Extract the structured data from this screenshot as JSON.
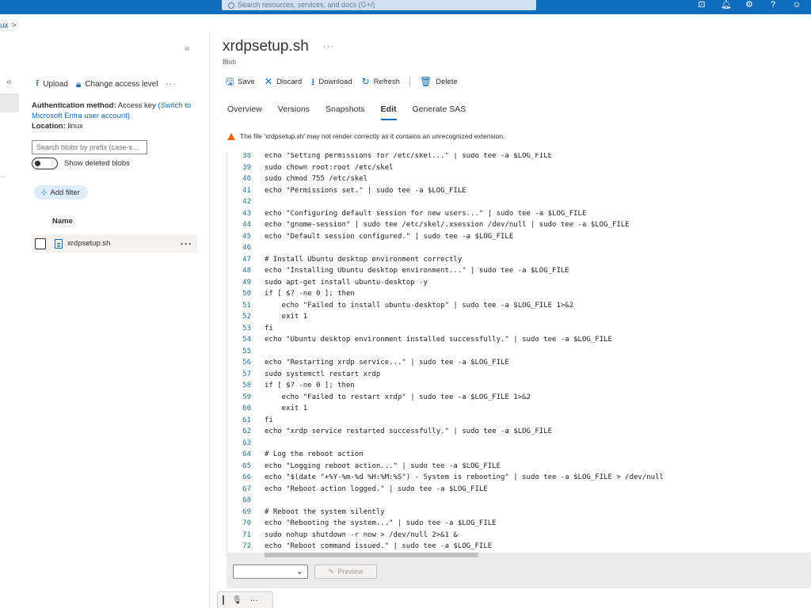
{
  "topbar": {
    "search_placeholder": "Search resources, services, and docs (G+/)",
    "icons": [
      "cloud-shell-icon",
      "notifications-icon",
      "settings-icon",
      "help-icon",
      "feedback-icon"
    ]
  },
  "breadcrumb": {
    "last": "ux",
    "separator": ">"
  },
  "left": {
    "collapse": "«",
    "collapse2": "«",
    "toolbar": {
      "upload": "Upload",
      "change_access": "Change access level",
      "more": "···"
    },
    "auth_label": "Authentication method:",
    "auth_value": "Access key",
    "auth_link": "(Switch to Microsoft Entra user account)",
    "location_label": "Location:",
    "location_value": "linux",
    "search_placeholder": "Search blobs by prefix (case-s...",
    "show_deleted": "Show deleted blobs",
    "add_filter": "Add filter",
    "column_name": "Name",
    "blobs": [
      {
        "name": "xrdpsetup.sh",
        "more": "···"
      }
    ]
  },
  "right": {
    "title": "xrdpsetup.sh",
    "title_more": "···",
    "subtitle": "Blob",
    "commands": {
      "save": "Save",
      "discard": "Discard",
      "download": "Download",
      "refresh": "Refresh",
      "delete": "Delete"
    },
    "tabs": [
      "Overview",
      "Versions",
      "Snapshots",
      "Edit",
      "Generate SAS"
    ],
    "active_tab": "Edit",
    "warning": "The file 'xrdpsetup.sh' may not render correctly as it contains an unrecognized extension.",
    "preview_label": "Preview"
  },
  "editor": {
    "lines": [
      {
        "n": "38",
        "t": "echo \"Setting permissions for /etc/skel...\" | sudo tee -a $LOG_FILE"
      },
      {
        "n": "39",
        "t": "sudo chown root:root /etc/skel"
      },
      {
        "n": "40",
        "t": "sudo chmod 755 /etc/skel"
      },
      {
        "n": "41",
        "t": "echo \"Permissions set.\" | sudo tee -a $LOG_FILE"
      },
      {
        "n": "42",
        "t": ""
      },
      {
        "n": "43",
        "t": "echo \"Configuring default session for new users...\" | sudo tee -a $LOG_FILE"
      },
      {
        "n": "44",
        "t": "echo \"gnome-session\" | sudo tee /etc/skel/.xsession /dev/null | sudo tee -a $LOG_FILE"
      },
      {
        "n": "45",
        "t": "echo \"Default session configured.\" | sudo tee -a $LOG_FILE"
      },
      {
        "n": "46",
        "t": ""
      },
      {
        "n": "47",
        "t": "# Install Ubuntu desktop environment correctly"
      },
      {
        "n": "48",
        "t": "echo \"Installing Ubuntu desktop environment...\" | sudo tee -a $LOG_FILE"
      },
      {
        "n": "49",
        "t": "sudo apt-get install ubuntu-desktop -y"
      },
      {
        "n": "50",
        "t": "if [ $? -ne 0 ]; then"
      },
      {
        "n": "51",
        "t": "    echo \"Failed to install ubuntu-desktop\" | sudo tee -a $LOG_FILE 1>&2"
      },
      {
        "n": "52",
        "t": "    exit 1"
      },
      {
        "n": "53",
        "t": "fi"
      },
      {
        "n": "54",
        "t": "echo \"Ubuntu desktop environment installed successfully.\" | sudo tee -a $LOG_FILE"
      },
      {
        "n": "55",
        "t": ""
      },
      {
        "n": "56",
        "t": "echo \"Restarting xrdp service...\" | sudo tee -a $LOG_FILE"
      },
      {
        "n": "57",
        "t": "sudo systemctl restart xrdp"
      },
      {
        "n": "58",
        "t": "if [ $? -ne 0 ]; then"
      },
      {
        "n": "59",
        "t": "    echo \"Failed to restart xrdp\" | sudo tee -a $LOG_FILE 1>&2"
      },
      {
        "n": "60",
        "t": "    exit 1"
      },
      {
        "n": "61",
        "t": "fi"
      },
      {
        "n": "62",
        "t": "echo \"xrdp service restarted successfully.\" | sudo tee -a $LOG_FILE"
      },
      {
        "n": "63",
        "t": ""
      },
      {
        "n": "64",
        "t": "# Log the reboot action"
      },
      {
        "n": "65",
        "t": "echo \"Logging reboot action...\" | sudo tee -a $LOG_FILE"
      },
      {
        "n": "66",
        "t": "echo \"$(date \"+%Y-%m-%d %H:%M:%S\") - System is rebooting\" | sudo tee -a $LOG_FILE > /dev/null"
      },
      {
        "n": "67",
        "t": "echo \"Reboot action logged.\" | sudo tee -a $LOG_FILE"
      },
      {
        "n": "68",
        "t": ""
      },
      {
        "n": "69",
        "t": "# Reboot the system silently"
      },
      {
        "n": "70",
        "t": "echo \"Rebooting the system...\" | sudo tee -a $LOG_FILE"
      },
      {
        "n": "71",
        "t": "sudo nohup shutdown -r now > /dev/null 2>&1 &"
      },
      {
        "n": "72",
        "t": "echo \"Reboot command issued.\" | sudo tee -a $LOG_FILE"
      }
    ]
  },
  "floatbar": {
    "more": "···"
  },
  "colors": {
    "accent": "#0f6cbd",
    "warning": "#f7630c"
  }
}
